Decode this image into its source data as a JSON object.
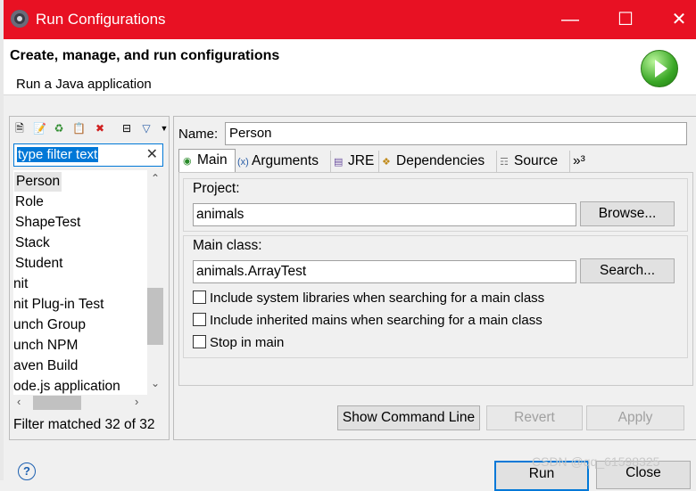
{
  "window": {
    "title": "Run Configurations",
    "controls": [
      "minimize-icon",
      "maximize-icon",
      "close-icon"
    ]
  },
  "header": {
    "title": "Create, manage, and run configurations",
    "subtitle": "Run a Java application",
    "icon": "run-icon"
  },
  "left_panel": {
    "filter_placeholder": "type filter text",
    "tree_items": [
      "Person",
      "Role",
      "ShapeTest",
      "Stack",
      "Student",
      "nit",
      "nit Plug-in Test",
      "unch Group",
      "unch NPM",
      "aven Build",
      "ode.js application"
    ],
    "selected": "Person",
    "status": "Filter matched 32 of 32"
  },
  "right_panel": {
    "name_label": "Name:",
    "name_value": "Person",
    "tabs": [
      "Main",
      "Arguments",
      "JRE",
      "Dependencies",
      "Source",
      "»³"
    ],
    "active_tab": "Main",
    "project_label": "Project:",
    "project_value": "animals",
    "browse_label": "Browse...",
    "main_class_label": "Main class:",
    "main_class_value": "animals.ArrayTest",
    "search_label": "Search...",
    "checkboxes": [
      {
        "label": "Include system libraries when searching for a main class",
        "checked": false
      },
      {
        "label": "Include inherited mains when searching for a main class",
        "checked": false
      },
      {
        "label": "Stop in main",
        "checked": false
      }
    ],
    "show_command_line_label": "Show Command Line",
    "revert_label": "Revert",
    "apply_label": "Apply"
  },
  "footer": {
    "help_icon": "help-icon",
    "help_glyph": "?",
    "run_label": "Run",
    "close_label": "Close",
    "watermark": "CSDN @qq_61598325"
  }
}
